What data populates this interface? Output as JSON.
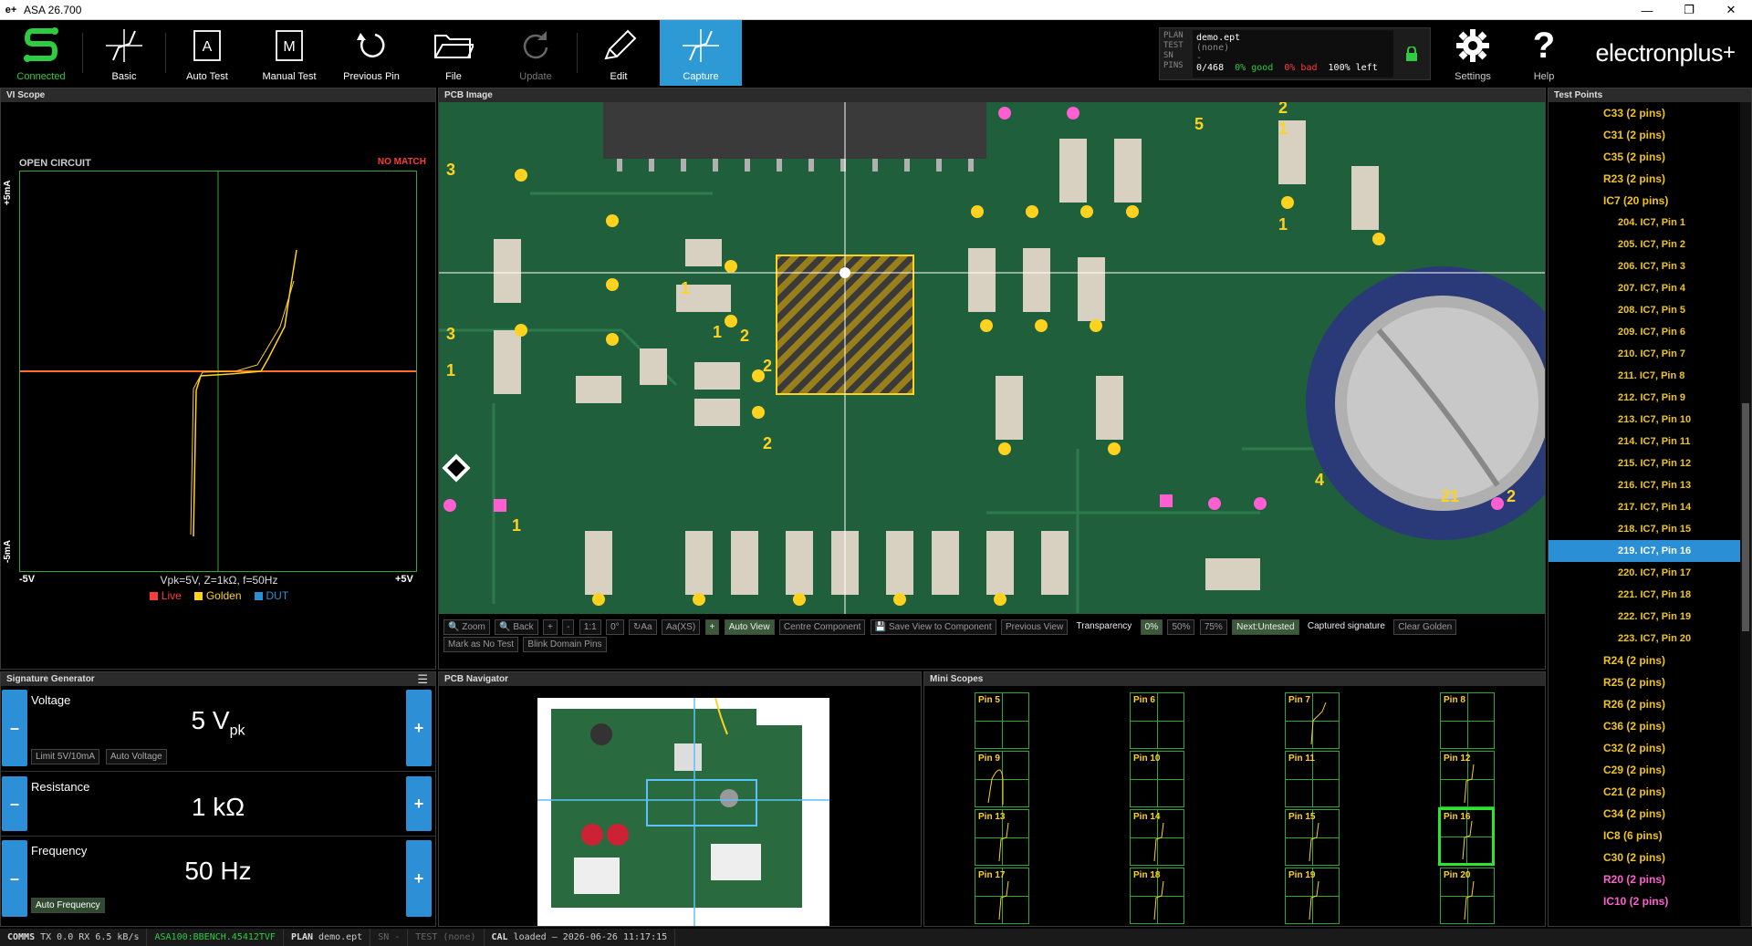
{
  "window": {
    "title": "ASA 26.700",
    "icon": "e+"
  },
  "toolbar": {
    "connected": "Connected",
    "basic": "Basic",
    "auto_test": "Auto Test",
    "manual_test": "Manual Test",
    "previous_pin": "Previous Pin",
    "file": "File",
    "update": "Update",
    "edit": "Edit",
    "capture": "Capture",
    "settings": "Settings",
    "help": "Help",
    "brand": "electronplus",
    "plan_labels": [
      "PLAN",
      "TEST",
      "SN",
      "PINS"
    ],
    "plan_value": "demo.ept",
    "test_value": "(none)",
    "sn_value": "-",
    "pins_value": "0/468",
    "good": "0% good",
    "bad": "0% bad",
    "left": "100% left"
  },
  "vi_scope": {
    "title": "VI Scope",
    "status": "OPEN CIRCUIT",
    "match": "NO MATCH",
    "y_top": "+5mA",
    "y_bottom": "-5mA",
    "x_left": "-5V",
    "x_right": "+5V",
    "params": "Vpk=5V, Z=1kΩ, f=50Hz",
    "legend": [
      "Live",
      "Golden",
      "DUT"
    ],
    "colors": {
      "live": "#ff3b3b",
      "golden": "#ffd21f",
      "dut": "#2b8fd6",
      "grid": "#2ea82e"
    }
  },
  "pcb_image": {
    "title": "PCB Image",
    "controls": [
      "Zoom",
      "Back",
      "+",
      "-",
      "1:1",
      "0°",
      "Aa",
      "Aa(XS)",
      "+",
      "Auto View",
      "Centre Component",
      "Save View to Component",
      "Previous View"
    ],
    "transparency_label": "Transparency",
    "transparency_options": [
      "0%",
      "50%",
      "75%"
    ],
    "next_untested": "Next:Untested",
    "captured": "Captured signature",
    "clear_golden": "Clear Golden",
    "mark_no_test": "Mark as No Test",
    "blink": "Blink Domain Pins"
  },
  "signature_generator": {
    "title": "Signature Generator",
    "voltage_label": "Voltage",
    "voltage_value": "5 V",
    "voltage_unit_sub": "pk",
    "limit_btn": "Limit 5V/10mA",
    "auto_voltage": "Auto Voltage",
    "resistance_label": "Resistance",
    "resistance_value": "1 kΩ",
    "frequency_label": "Frequency",
    "frequency_value": "50 Hz",
    "auto_frequency": "Auto Frequency",
    "minus": "–",
    "plus": "+"
  },
  "pcb_navigator": {
    "title": "PCB Navigator"
  },
  "mini_scopes": {
    "title": "Mini Scopes",
    "pins": [
      "Pin 5",
      "Pin 6",
      "Pin 7",
      "Pin 8",
      "Pin 9",
      "Pin 10",
      "Pin 11",
      "Pin 12",
      "Pin 13",
      "Pin 14",
      "Pin 15",
      "Pin 16",
      "Pin 17",
      "Pin 18",
      "Pin 19",
      "Pin 20"
    ],
    "selected": "Pin 16"
  },
  "test_points": {
    "title": "Test Points",
    "items": [
      {
        "label": "C33 (2 pins)",
        "level": 1,
        "color": "yellow"
      },
      {
        "label": "C31 (2 pins)",
        "level": 1,
        "color": "yellow"
      },
      {
        "label": "C35 (2 pins)",
        "level": 1,
        "color": "yellow"
      },
      {
        "label": "R23 (2 pins)",
        "level": 1,
        "color": "yellow"
      },
      {
        "label": "IC7 (20 pins)",
        "level": 1,
        "color": "yellow"
      },
      {
        "label": "204. IC7, Pin 1",
        "level": 2,
        "color": "yellow"
      },
      {
        "label": "205. IC7, Pin 2",
        "level": 2,
        "color": "yellow"
      },
      {
        "label": "206. IC7, Pin 3",
        "level": 2,
        "color": "yellow"
      },
      {
        "label": "207. IC7, Pin 4",
        "level": 2,
        "color": "yellow"
      },
      {
        "label": "208. IC7, Pin 5",
        "level": 2,
        "color": "yellow"
      },
      {
        "label": "209. IC7, Pin 6",
        "level": 2,
        "color": "yellow"
      },
      {
        "label": "210. IC7, Pin 7",
        "level": 2,
        "color": "yellow"
      },
      {
        "label": "211. IC7, Pin 8",
        "level": 2,
        "color": "yellow"
      },
      {
        "label": "212. IC7, Pin 9",
        "level": 2,
        "color": "yellow"
      },
      {
        "label": "213. IC7, Pin 10",
        "level": 2,
        "color": "yellow"
      },
      {
        "label": "214. IC7, Pin 11",
        "level": 2,
        "color": "yellow"
      },
      {
        "label": "215. IC7, Pin 12",
        "level": 2,
        "color": "yellow"
      },
      {
        "label": "216. IC7, Pin 13",
        "level": 2,
        "color": "yellow"
      },
      {
        "label": "217. IC7, Pin 14",
        "level": 2,
        "color": "yellow"
      },
      {
        "label": "218. IC7, Pin 15",
        "level": 2,
        "color": "yellow"
      },
      {
        "label": "219. IC7, Pin 16",
        "level": 2,
        "color": "selected"
      },
      {
        "label": "220. IC7, Pin 17",
        "level": 2,
        "color": "yellow"
      },
      {
        "label": "221. IC7, Pin 18",
        "level": 2,
        "color": "yellow"
      },
      {
        "label": "222. IC7, Pin 19",
        "level": 2,
        "color": "yellow"
      },
      {
        "label": "223. IC7, Pin 20",
        "level": 2,
        "color": "yellow"
      },
      {
        "label": "R24 (2 pins)",
        "level": 1,
        "color": "yellow"
      },
      {
        "label": "R25 (2 pins)",
        "level": 1,
        "color": "yellow"
      },
      {
        "label": "R26 (2 pins)",
        "level": 1,
        "color": "yellow"
      },
      {
        "label": "C36 (2 pins)",
        "level": 1,
        "color": "yellow"
      },
      {
        "label": "C32 (2 pins)",
        "level": 1,
        "color": "yellow"
      },
      {
        "label": "C29 (2 pins)",
        "level": 1,
        "color": "yellow"
      },
      {
        "label": "C21 (2 pins)",
        "level": 1,
        "color": "yellow"
      },
      {
        "label": "C34 (2 pins)",
        "level": 1,
        "color": "yellow"
      },
      {
        "label": "IC8 (6 pins)",
        "level": 1,
        "color": "yellow"
      },
      {
        "label": "C30 (2 pins)",
        "level": 1,
        "color": "yellow"
      },
      {
        "label": "R20 (2 pins)",
        "level": 1,
        "color": "pink"
      },
      {
        "label": "IC10 (2 pins)",
        "level": 1,
        "color": "pink"
      }
    ]
  },
  "statusbar": {
    "comms_k": "COMMS",
    "comms_v": "TX 0.0  RX 6.5 kB/s",
    "device": "ASA100:BBENCH.45412TVF",
    "plan_k": "PLAN",
    "plan_v": "demo.ept",
    "sn_k": "SN",
    "sn_v": "-",
    "test_k": "TEST",
    "test_v": "(none)",
    "cal_k": "CAL",
    "cal_v": "loaded – 2026-06-26 11:17:15"
  }
}
